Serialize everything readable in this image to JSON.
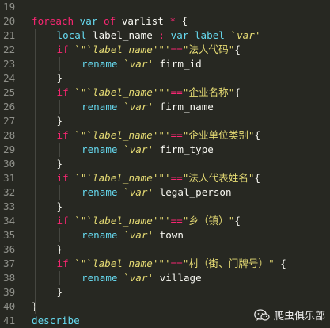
{
  "editor": {
    "lines": [
      {
        "num": "19",
        "tokens": []
      },
      {
        "num": "20",
        "indent": 0,
        "tokens": [
          {
            "c": "kw",
            "t": "foreach"
          },
          {
            "c": "plain",
            "t": " "
          },
          {
            "c": "fn",
            "t": "var"
          },
          {
            "c": "plain",
            "t": " "
          },
          {
            "c": "kw",
            "t": "of"
          },
          {
            "c": "plain",
            "t": " varlist "
          },
          {
            "c": "kw",
            "t": "*"
          },
          {
            "c": "plain",
            "t": " {"
          }
        ]
      },
      {
        "num": "21",
        "indent": 1,
        "tokens": [
          {
            "c": "fn",
            "t": "local"
          },
          {
            "c": "plain",
            "t": " label_name "
          },
          {
            "c": "kw",
            "t": ":"
          },
          {
            "c": "plain",
            "t": " "
          },
          {
            "c": "fn",
            "t": "var"
          },
          {
            "c": "plain",
            "t": " "
          },
          {
            "c": "fn",
            "t": "label"
          },
          {
            "c": "plain",
            "t": " "
          },
          {
            "c": "str",
            "t": "`"
          },
          {
            "c": "str it",
            "t": "var"
          },
          {
            "c": "str",
            "t": "'"
          }
        ]
      },
      {
        "num": "22",
        "indent": 1,
        "tokens": [
          {
            "c": "kw",
            "t": "if"
          },
          {
            "c": "plain",
            "t": " "
          },
          {
            "c": "str",
            "t": "`\"`"
          },
          {
            "c": "str it",
            "t": "label_name"
          },
          {
            "c": "str",
            "t": "'\"'"
          },
          {
            "c": "kw",
            "t": "=="
          },
          {
            "c": "str",
            "t": "\"法人代码\""
          },
          {
            "c": "plain",
            "t": "{"
          }
        ]
      },
      {
        "num": "23",
        "indent": 2,
        "tokens": [
          {
            "c": "fn",
            "t": "rename"
          },
          {
            "c": "plain",
            "t": " "
          },
          {
            "c": "str",
            "t": "`"
          },
          {
            "c": "str it",
            "t": "var"
          },
          {
            "c": "str",
            "t": "'"
          },
          {
            "c": "plain",
            "t": " firm_id"
          }
        ]
      },
      {
        "num": "24",
        "indent": 1,
        "tokens": [
          {
            "c": "plain",
            "t": "}"
          }
        ]
      },
      {
        "num": "25",
        "indent": 1,
        "tokens": [
          {
            "c": "kw",
            "t": "if"
          },
          {
            "c": "plain",
            "t": " "
          },
          {
            "c": "str",
            "t": "`\"`"
          },
          {
            "c": "str it",
            "t": "label_name"
          },
          {
            "c": "str",
            "t": "'\"'"
          },
          {
            "c": "kw",
            "t": "=="
          },
          {
            "c": "str",
            "t": "\"企业名称\""
          },
          {
            "c": "plain",
            "t": "{"
          }
        ]
      },
      {
        "num": "26",
        "indent": 2,
        "tokens": [
          {
            "c": "fn",
            "t": "rename"
          },
          {
            "c": "plain",
            "t": " "
          },
          {
            "c": "str",
            "t": "`"
          },
          {
            "c": "str it",
            "t": "var"
          },
          {
            "c": "str",
            "t": "'"
          },
          {
            "c": "plain",
            "t": " firm_name"
          }
        ]
      },
      {
        "num": "27",
        "indent": 1,
        "tokens": [
          {
            "c": "plain",
            "t": "}"
          }
        ]
      },
      {
        "num": "28",
        "indent": 1,
        "tokens": [
          {
            "c": "kw",
            "t": "if"
          },
          {
            "c": "plain",
            "t": " "
          },
          {
            "c": "str",
            "t": "`\"`"
          },
          {
            "c": "str it",
            "t": "label_name"
          },
          {
            "c": "str",
            "t": "'\"'"
          },
          {
            "c": "kw",
            "t": "=="
          },
          {
            "c": "str",
            "t": "\"企业单位类别\""
          },
          {
            "c": "plain",
            "t": "{"
          }
        ]
      },
      {
        "num": "29",
        "indent": 2,
        "tokens": [
          {
            "c": "fn",
            "t": "rename"
          },
          {
            "c": "plain",
            "t": " "
          },
          {
            "c": "str",
            "t": "`"
          },
          {
            "c": "str it",
            "t": "var"
          },
          {
            "c": "str",
            "t": "'"
          },
          {
            "c": "plain",
            "t": " firm_type"
          }
        ]
      },
      {
        "num": "30",
        "indent": 1,
        "tokens": [
          {
            "c": "plain",
            "t": "}"
          }
        ]
      },
      {
        "num": "31",
        "indent": 1,
        "tokens": [
          {
            "c": "kw",
            "t": "if"
          },
          {
            "c": "plain",
            "t": " "
          },
          {
            "c": "str",
            "t": "`\"`"
          },
          {
            "c": "str it",
            "t": "label_name"
          },
          {
            "c": "str",
            "t": "'\"'"
          },
          {
            "c": "kw",
            "t": "=="
          },
          {
            "c": "str",
            "t": "\"法人代表姓名\""
          },
          {
            "c": "plain",
            "t": "{"
          }
        ]
      },
      {
        "num": "32",
        "indent": 2,
        "tokens": [
          {
            "c": "fn",
            "t": "rename"
          },
          {
            "c": "plain",
            "t": " "
          },
          {
            "c": "str",
            "t": "`"
          },
          {
            "c": "str it",
            "t": "var"
          },
          {
            "c": "str",
            "t": "'"
          },
          {
            "c": "plain",
            "t": " legal_person"
          }
        ]
      },
      {
        "num": "33",
        "indent": 1,
        "tokens": [
          {
            "c": "plain",
            "t": "}"
          }
        ]
      },
      {
        "num": "34",
        "indent": 1,
        "tokens": [
          {
            "c": "kw",
            "t": "if"
          },
          {
            "c": "plain",
            "t": " "
          },
          {
            "c": "str",
            "t": "`\"`"
          },
          {
            "c": "str it",
            "t": "label_name"
          },
          {
            "c": "str",
            "t": "'\"'"
          },
          {
            "c": "kw",
            "t": "=="
          },
          {
            "c": "str",
            "t": "\"乡（镇）\""
          },
          {
            "c": "plain",
            "t": "{"
          }
        ]
      },
      {
        "num": "35",
        "indent": 2,
        "tokens": [
          {
            "c": "fn",
            "t": "rename"
          },
          {
            "c": "plain",
            "t": " "
          },
          {
            "c": "str",
            "t": "`"
          },
          {
            "c": "str it",
            "t": "var"
          },
          {
            "c": "str",
            "t": "'"
          },
          {
            "c": "plain",
            "t": " town"
          }
        ]
      },
      {
        "num": "36",
        "indent": 1,
        "tokens": [
          {
            "c": "plain",
            "t": "}"
          }
        ]
      },
      {
        "num": "37",
        "indent": 1,
        "tokens": [
          {
            "c": "kw",
            "t": "if"
          },
          {
            "c": "plain",
            "t": " "
          },
          {
            "c": "str",
            "t": "`\"`"
          },
          {
            "c": "str it",
            "t": "label_name"
          },
          {
            "c": "str",
            "t": "'\"'"
          },
          {
            "c": "kw",
            "t": "=="
          },
          {
            "c": "str",
            "t": "\"村（街、门牌号）\""
          },
          {
            "c": "plain",
            "t": " {"
          }
        ]
      },
      {
        "num": "38",
        "indent": 2,
        "tokens": [
          {
            "c": "fn",
            "t": "rename"
          },
          {
            "c": "plain",
            "t": " "
          },
          {
            "c": "str",
            "t": "`"
          },
          {
            "c": "str it",
            "t": "var"
          },
          {
            "c": "str",
            "t": "'"
          },
          {
            "c": "plain",
            "t": " village"
          }
        ]
      },
      {
        "num": "39",
        "indent": 1,
        "tokens": [
          {
            "c": "plain",
            "t": "}"
          }
        ]
      },
      {
        "num": "40",
        "indent": 0,
        "tokens": [
          {
            "c": "plain",
            "t": "}"
          }
        ]
      },
      {
        "num": "41",
        "indent": 0,
        "tokens": [
          {
            "c": "fn",
            "t": "describe"
          }
        ]
      }
    ]
  },
  "watermark": {
    "icon": "wechat-icon",
    "text": "爬虫俱乐部"
  },
  "colors": {
    "background": "#272822",
    "keyword": "#f92672",
    "function": "#66d9ef",
    "string": "#e6db74",
    "text": "#f8f8f2",
    "line_number": "#8f908a"
  }
}
